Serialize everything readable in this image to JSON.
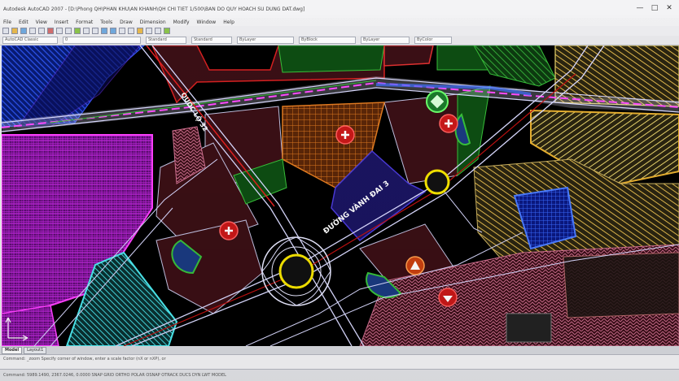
{
  "window": {
    "title": "Autodesk AutoCAD 2007 - [D:\\Phong QH\\PHAN KHU\\AN KHANH\\QH CHI TIET 1/500\\BAN DO QUY HOACH SU DUNG DAT.dwg]",
    "controls": [
      "—",
      "□",
      "✕"
    ]
  },
  "menu": [
    "File",
    "Edit",
    "View",
    "Insert",
    "Format",
    "Tools",
    "Draw",
    "Dimension",
    "Modify",
    "Window",
    "Help"
  ],
  "toolbar2": {
    "workspace": "AutoCAD Classic",
    "layer": "0",
    "text_style": "Standard",
    "dim_style": "Standard",
    "color": "ByLayer",
    "linetype": "ByBlock",
    "lineweight": "ByLayer",
    "plotstyle": "ByColor"
  },
  "map_labels": {
    "road_1": "QUỐC LỘ 32",
    "road_2": "ĐƯỜNG VÀNH ĐAI 3"
  },
  "tabs": [
    "Model",
    "Layout1"
  ],
  "command_line": "Command: _zoom  Specify corner of window, enter a scale factor (nX or nXP), or",
  "status_line": "Command:  5989.1490, 2367.0246, 0.0000    SNAP GRID ORTHO POLAR OSNAP OTRACK DUCS DYN LWT MODEL",
  "colors": {
    "background": "#000000",
    "parcel_fill": "#3a0f15",
    "road_lines": "#d9d9ff",
    "green_fill": "#0d4d12",
    "magenta_hatch": "#c21ee0",
    "blue_hatch": "#1e40d0",
    "orange_hatch": "#e07a20",
    "yellow_hatch": "#e8d46c",
    "hospital_icon": "#e8231b",
    "marker_yellow": "#f5e400"
  }
}
